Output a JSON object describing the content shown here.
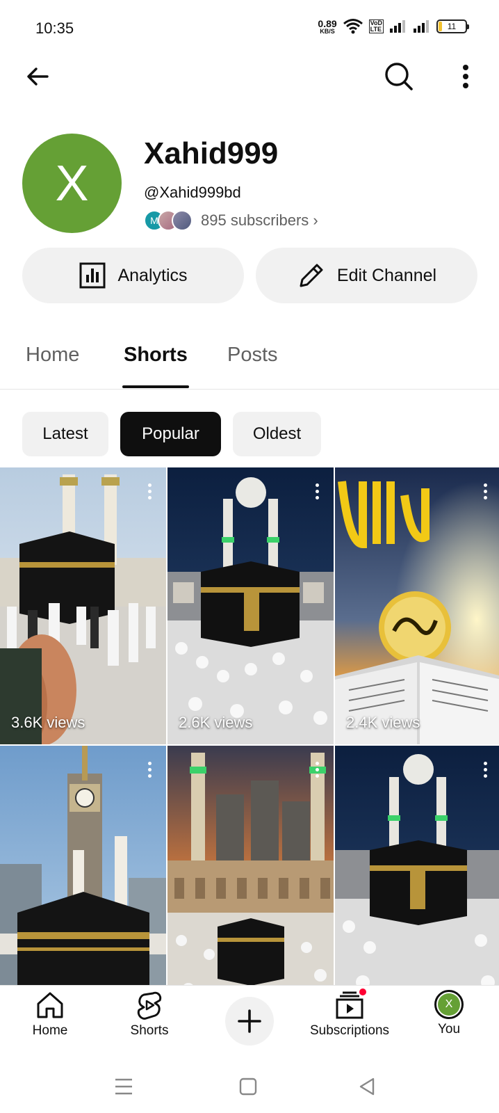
{
  "status_bar": {
    "time": "10:35",
    "net_speed_value": "0.89",
    "net_speed_unit": "KB/S",
    "volte_top": "VoD",
    "volte_bottom": "LTE",
    "battery_level": "11"
  },
  "top_bar": {
    "back_icon": "arrow-left-icon",
    "search_icon": "search-icon",
    "more_icon": "more-vert-icon"
  },
  "channel": {
    "avatar_letter": "X",
    "avatar_color": "#65a035",
    "name": "Xahid999",
    "handle": "@Xahid999bd",
    "subscriber_avatar_letter": "M",
    "subscribers": "895 subscribers",
    "subscribers_chevron": "›"
  },
  "actions": {
    "analytics_label": "Analytics",
    "edit_label": "Edit Channel"
  },
  "tabs": [
    {
      "label": "Home",
      "active": false
    },
    {
      "label": "Shorts",
      "active": true
    },
    {
      "label": "Posts",
      "active": false
    }
  ],
  "chips": [
    {
      "label": "Latest",
      "active": false
    },
    {
      "label": "Popular",
      "active": true
    },
    {
      "label": "Oldest",
      "active": false
    }
  ],
  "shorts": [
    {
      "views": "3.6K views"
    },
    {
      "views": "2.6K views"
    },
    {
      "views": "2.4K views"
    },
    {
      "views": ""
    },
    {
      "views": ""
    },
    {
      "views": ""
    }
  ],
  "bottom_nav": {
    "home": "Home",
    "shorts": "Shorts",
    "create_icon": "plus-icon",
    "subscriptions": "Subscriptions",
    "you": "You",
    "you_avatar_letter": "X"
  },
  "colors": {
    "accent": "#0f0f0f",
    "chip_bg": "#f1f1f1",
    "notification": "#ff0033"
  }
}
